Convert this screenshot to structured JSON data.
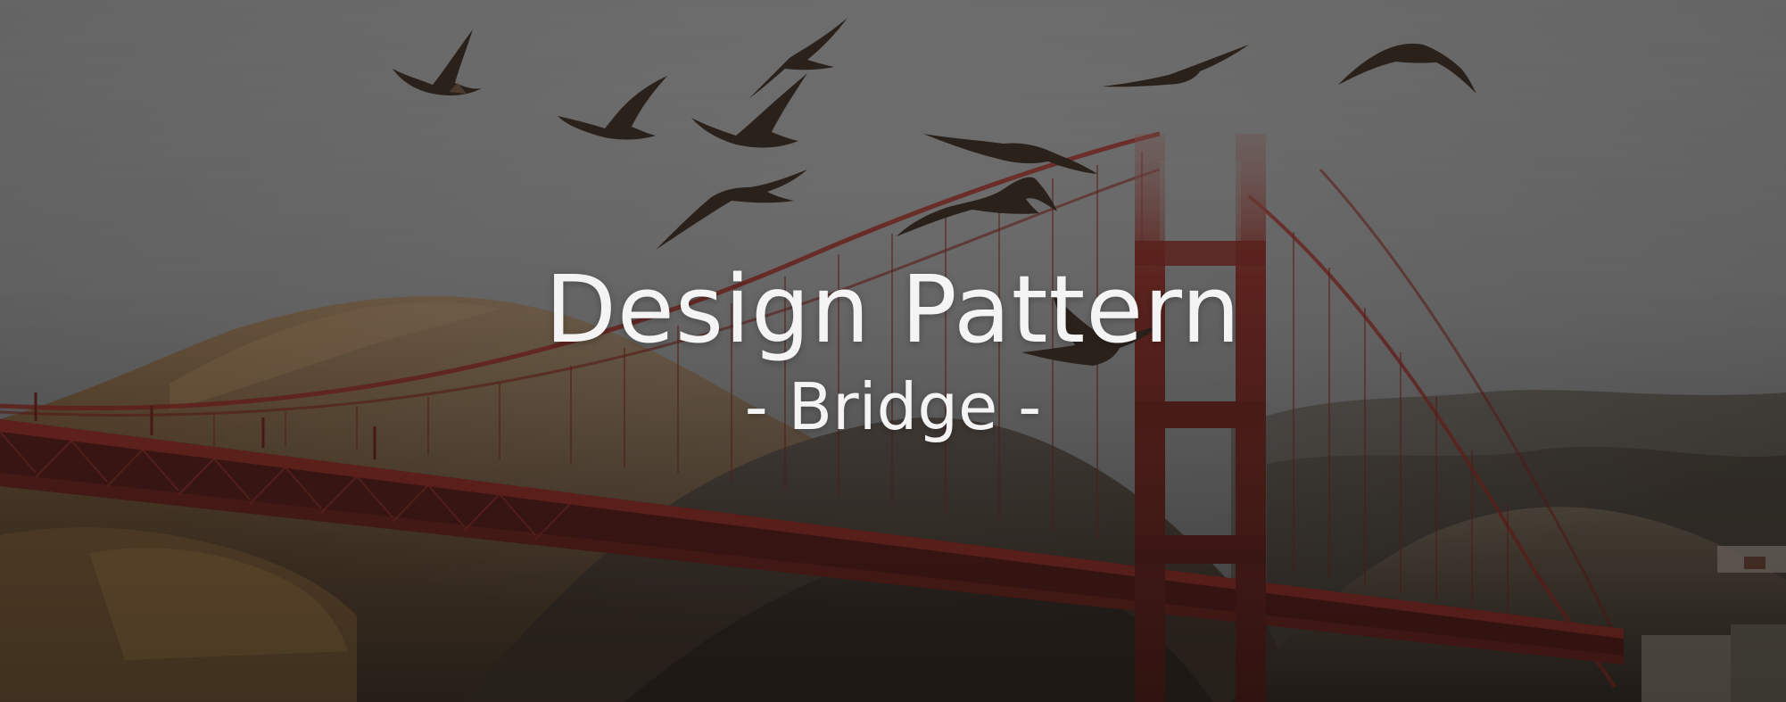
{
  "banner": {
    "title": "Design Pattern",
    "subtitle": "- Bridge -"
  },
  "scene": {
    "subjects": [
      "bridge",
      "pelicans",
      "hills",
      "fog"
    ],
    "colors": {
      "sky": "#6b6b6b",
      "fog": "#8a8a8a",
      "hill_light": "#7a5a36",
      "hill_dark": "#3b3127",
      "bridge": "#7a2a24",
      "bridge_dark": "#4a1a18",
      "bird": "#2a221c",
      "text": "#f4f4f4"
    }
  }
}
